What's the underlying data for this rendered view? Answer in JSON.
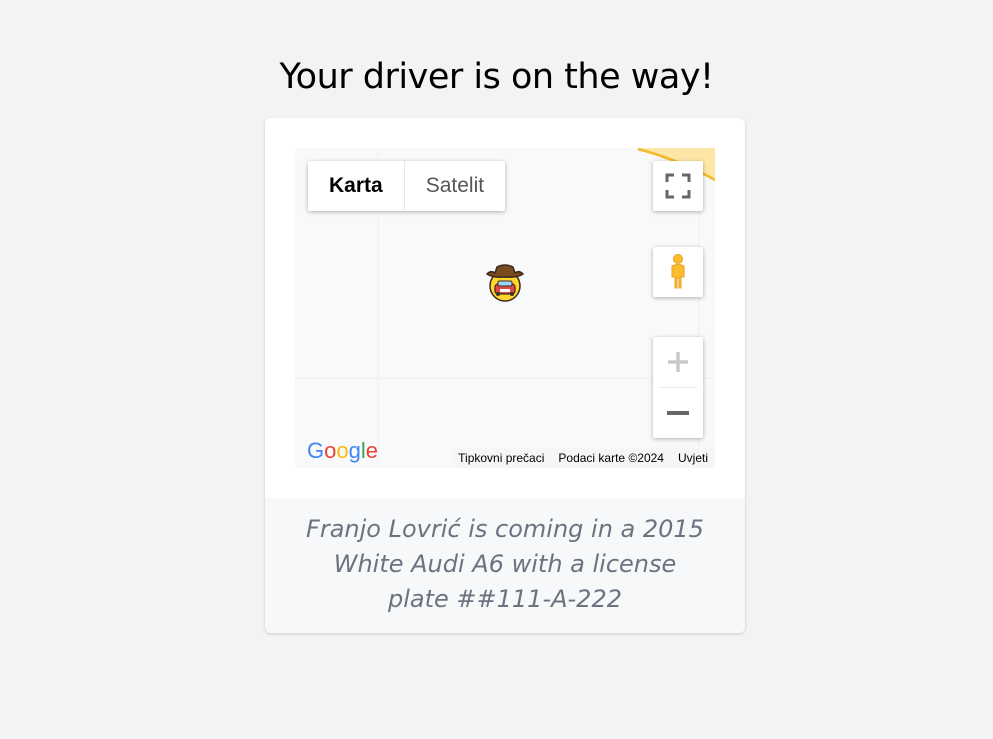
{
  "page": {
    "title": "Your driver is on the way!"
  },
  "map": {
    "map_types": [
      {
        "label": "Karta",
        "active": true
      },
      {
        "label": "Satelit",
        "active": false
      }
    ],
    "logo_text": "Google",
    "attribution": {
      "shortcuts": "Tipkovni prečaci",
      "map_data": "Podaci karte ©2024",
      "terms": "Uvjeti"
    },
    "icons": {
      "fullscreen": "fullscreen-icon",
      "street_view": "pegman-icon",
      "zoom_in": "plus-icon",
      "zoom_out": "minus-icon",
      "driver_marker": "cowboy-car-icon"
    }
  },
  "ride": {
    "description": "Franjo Lovrić is coming in a 2015 White Audi A6 with a license plate ##111-A-222"
  },
  "colors": {
    "background": "#f2f3f5",
    "card": "#ffffff",
    "footer_bg": "#f7f8fa",
    "footer_text": "#6c727f",
    "road": "#fbd36a"
  }
}
